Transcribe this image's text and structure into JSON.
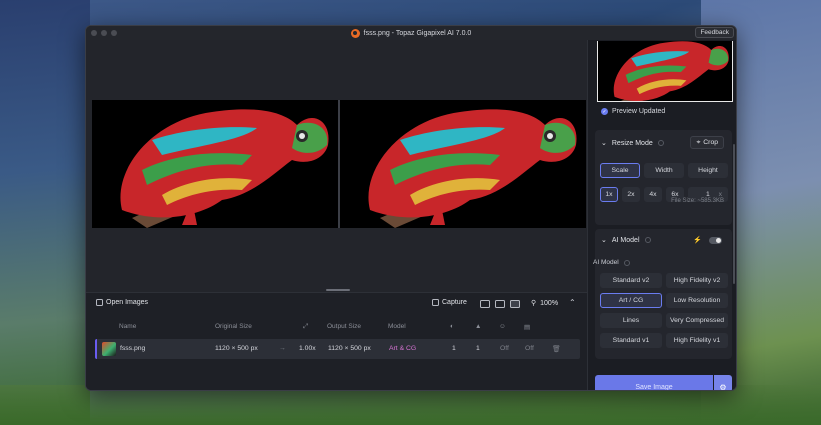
{
  "window": {
    "title": "fsss.png - Topaz Gigapixel AI 7.0.0",
    "feedback_label": "Feedback"
  },
  "bottom_toolbar": {
    "open_images_label": "Open Images",
    "capture_label": "Capture",
    "zoom_value": "100%"
  },
  "table": {
    "headers": {
      "name": "Name",
      "original_size": "Original Size",
      "output_size": "Output Size",
      "model": "Model"
    },
    "rows": [
      {
        "name": "fsss.png",
        "original_size": "1120 × 500 px",
        "scale": "1.00x",
        "output_size": "1120 × 500 px",
        "model": "Art & CG",
        "val1": "1",
        "val2": "1",
        "val3": "Off",
        "val4": "Off"
      }
    ]
  },
  "sidebar": {
    "preview_status": "Preview Updated",
    "resize": {
      "title": "Resize Mode",
      "crop_label": "Crop",
      "tabs": [
        "Scale",
        "Width",
        "Height"
      ],
      "selected_tab": "Scale",
      "scale_options": [
        "1x",
        "2x",
        "4x",
        "6x"
      ],
      "selected_scale": "1x",
      "custom_scale_value": "1",
      "custom_scale_unit": "x",
      "file_size": "File Size: ~585.3KB"
    },
    "ai_model": {
      "title": "AI Model",
      "subtitle": "AI Model",
      "models": [
        [
          "Standard v2",
          "High Fidelity v2"
        ],
        [
          "Art / CG",
          "Low Resolution"
        ],
        [
          "Lines",
          "Very Compressed"
        ],
        [
          "Standard v1",
          "High Fidelity v1"
        ]
      ],
      "selected_model": "Art / CG"
    },
    "save_label": "Save Image"
  },
  "colors": {
    "accent": "#6a78e8",
    "model_text": "#d774d3",
    "window_bg": "#1b1d23"
  }
}
